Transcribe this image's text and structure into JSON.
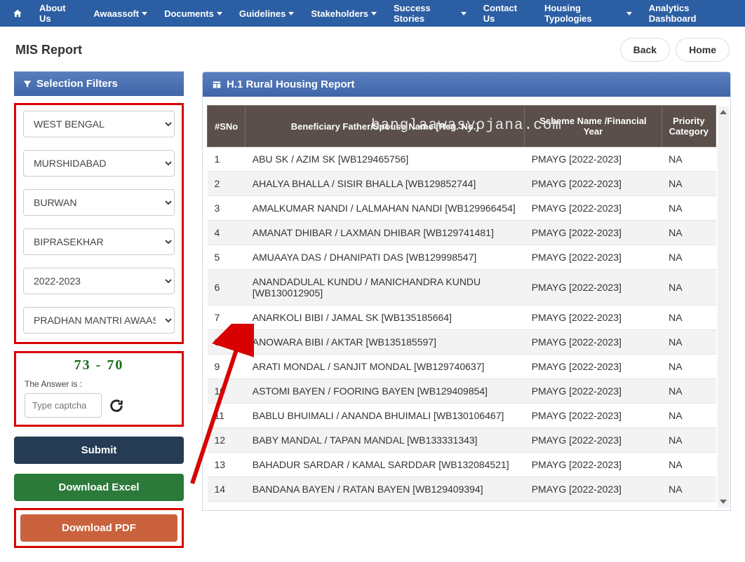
{
  "nav": {
    "items": [
      "About Us",
      "Awaassoft",
      "Documents",
      "Guidelines",
      "Stakeholders",
      "Success Stories",
      "Contact Us",
      "Housing Typologies"
    ],
    "right": "Analytics Dashboard"
  },
  "title": "MIS Report",
  "btn_back": "Back",
  "btn_home": "Home",
  "filters": {
    "title": "Selection Filters",
    "state": "WEST BENGAL",
    "district": "MURSHIDABAD",
    "block": "BURWAN",
    "gp": "BIPRASEKHAR",
    "year": "2022-2023",
    "scheme": "PRADHAN MANTRI AWAAS"
  },
  "captcha": {
    "question": "73 - 70",
    "label": "The Answer is :",
    "placeholder": "Type captcha"
  },
  "actions": {
    "submit": "Submit",
    "excel": "Download Excel",
    "pdf": "Download PDF"
  },
  "report": {
    "title": "H.1 Rural Housing Report",
    "watermark": "banglaawasyojana.com",
    "cols": {
      "sn": "#SNo",
      "ben": "Beneficiary Father/Spouse Name [Reg. No.]",
      "sc": "Scheme Name /Financial Year",
      "pc": "Priority Category"
    },
    "rows": [
      {
        "sn": "1",
        "ben": "ABU SK / AZIM SK [WB129465756]",
        "sc": "PMAYG [2022-2023]",
        "pc": "NA"
      },
      {
        "sn": "2",
        "ben": "AHALYA BHALLA / SISIR BHALLA [WB129852744]",
        "sc": "PMAYG [2022-2023]",
        "pc": "NA"
      },
      {
        "sn": "3",
        "ben": "AMALKUMAR NANDI / LALMAHAN NANDI [WB129966454]",
        "sc": "PMAYG [2022-2023]",
        "pc": "NA"
      },
      {
        "sn": "4",
        "ben": "AMANAT DHIBAR / LAXMAN DHIBAR [WB129741481]",
        "sc": "PMAYG [2022-2023]",
        "pc": "NA"
      },
      {
        "sn": "5",
        "ben": "AMUAAYA DAS / DHANIPATI DAS [WB129998547]",
        "sc": "PMAYG [2022-2023]",
        "pc": "NA"
      },
      {
        "sn": "6",
        "ben": "ANANDADULAL KUNDU / MANICHANDRA KUNDU [WB130012905]",
        "sc": "PMAYG [2022-2023]",
        "pc": "NA"
      },
      {
        "sn": "7",
        "ben": "ANARKOLI BIBI / JAMAL SK [WB135185664]",
        "sc": "PMAYG [2022-2023]",
        "pc": "NA"
      },
      {
        "sn": "8",
        "ben": "ANOWARA BIBI / AKTAR [WB135185597]",
        "sc": "PMAYG [2022-2023]",
        "pc": "NA"
      },
      {
        "sn": "9",
        "ben": "ARATI MONDAL / SANJIT MONDAL [WB129740637]",
        "sc": "PMAYG [2022-2023]",
        "pc": "NA"
      },
      {
        "sn": "10",
        "ben": "ASTOMI BAYEN / FOORING BAYEN [WB129409854]",
        "sc": "PMAYG [2022-2023]",
        "pc": "NA"
      },
      {
        "sn": "11",
        "ben": "BABLU BHUIMALI / ANANDA BHUIMALI [WB130106467]",
        "sc": "PMAYG [2022-2023]",
        "pc": "NA"
      },
      {
        "sn": "12",
        "ben": "BABY MANDAL / TAPAN MANDAL [WB133331343]",
        "sc": "PMAYG [2022-2023]",
        "pc": "NA"
      },
      {
        "sn": "13",
        "ben": "BAHADUR SARDAR / KAMAL SARDDAR [WB132084521]",
        "sc": "PMAYG [2022-2023]",
        "pc": "NA"
      },
      {
        "sn": "14",
        "ben": "BANDANA BAYEN / RATAN BAYEN [WB129409394]",
        "sc": "PMAYG [2022-2023]",
        "pc": "NA"
      }
    ]
  }
}
